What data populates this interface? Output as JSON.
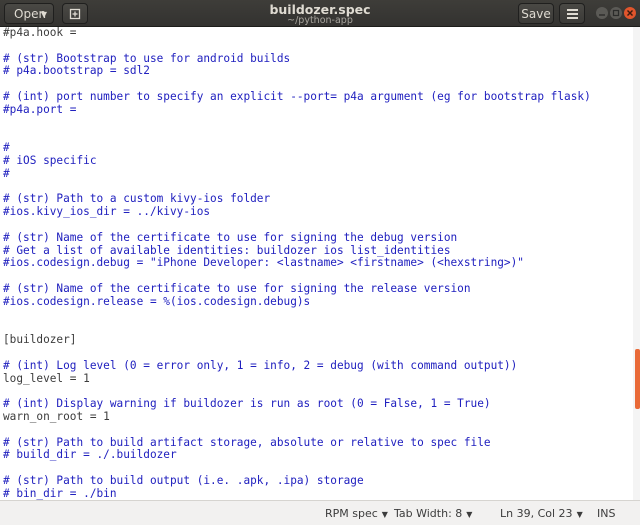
{
  "window": {
    "title": "buildozer.spec",
    "subtitle": "~/python-app",
    "open_label": "Open",
    "save_label": "Save"
  },
  "editor": {
    "lines": [
      {
        "text": "#p4a.hook =",
        "comment": false
      },
      {
        "text": "",
        "comment": false
      },
      {
        "text": "# (str) Bootstrap to use for android builds",
        "comment": true
      },
      {
        "text": "# p4a.bootstrap = sdl2",
        "comment": true
      },
      {
        "text": "",
        "comment": false
      },
      {
        "text": "# (int) port number to specify an explicit --port= p4a argument (eg for bootstrap flask)",
        "comment": true
      },
      {
        "text": "#p4a.port =",
        "comment": true
      },
      {
        "text": "",
        "comment": false
      },
      {
        "text": "",
        "comment": false
      },
      {
        "text": "#",
        "comment": true
      },
      {
        "text": "# iOS specific",
        "comment": true
      },
      {
        "text": "#",
        "comment": true
      },
      {
        "text": "",
        "comment": false
      },
      {
        "text": "# (str) Path to a custom kivy-ios folder",
        "comment": true
      },
      {
        "text": "#ios.kivy_ios_dir = ../kivy-ios",
        "comment": true
      },
      {
        "text": "",
        "comment": false
      },
      {
        "text": "# (str) Name of the certificate to use for signing the debug version",
        "comment": true
      },
      {
        "text": "# Get a list of available identities: buildozer ios list_identities",
        "comment": true
      },
      {
        "text": "#ios.codesign.debug = \"iPhone Developer: <lastname> <firstname> (<hexstring>)\"",
        "comment": true
      },
      {
        "text": "",
        "comment": false
      },
      {
        "text": "# (str) Name of the certificate to use for signing the release version",
        "comment": true
      },
      {
        "text": "#ios.codesign.release = %(ios.codesign.debug)s",
        "comment": true
      },
      {
        "text": "",
        "comment": false
      },
      {
        "text": "",
        "comment": false
      },
      {
        "text": "[buildozer]",
        "comment": false
      },
      {
        "text": "",
        "comment": false
      },
      {
        "text": "# (int) Log level (0 = error only, 1 = info, 2 = debug (with command output))",
        "comment": true
      },
      {
        "text": "log_level = 1",
        "comment": false
      },
      {
        "text": "",
        "comment": false
      },
      {
        "text": "# (int) Display warning if buildozer is run as root (0 = False, 1 = True)",
        "comment": true
      },
      {
        "text": "warn_on_root = 1",
        "comment": false
      },
      {
        "text": "",
        "comment": false
      },
      {
        "text": "# (str) Path to build artifact storage, absolute or relative to spec file",
        "comment": true
      },
      {
        "text": "# build_dir = ./.buildozer",
        "comment": true
      },
      {
        "text": "",
        "comment": false
      },
      {
        "text": "# (str) Path to build output (i.e. .apk, .ipa) storage",
        "comment": true
      },
      {
        "text": "# bin_dir = ./bin",
        "comment": true
      }
    ]
  },
  "statusbar": {
    "language": "RPM spec",
    "tab_width": "Tab Width: 8",
    "position": "Ln 39, Col 23",
    "mode": "INS"
  },
  "scrollbar": {
    "position_fraction": 0.78
  },
  "colors": {
    "comment": "#2020bf",
    "accent": "#e96a38",
    "text": "#3c3c3c"
  }
}
